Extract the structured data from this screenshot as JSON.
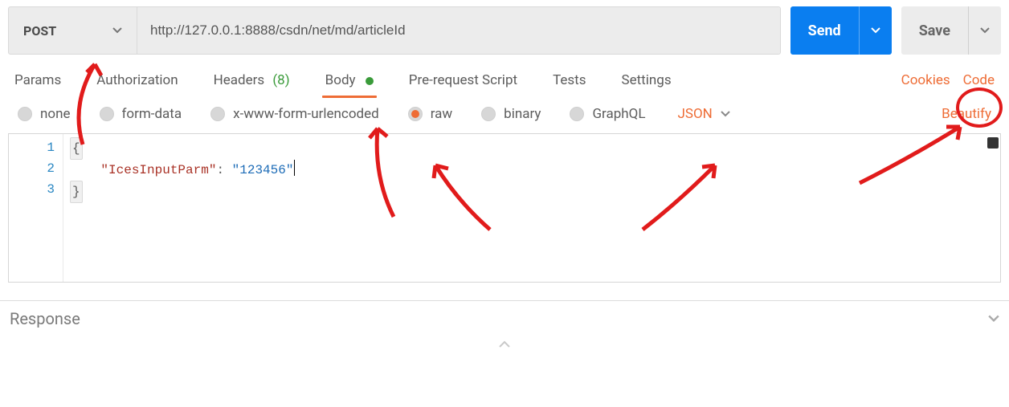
{
  "request": {
    "method": "POST",
    "url": "http://127.0.0.1:8888/csdn/net/md/articleId",
    "send_label": "Send",
    "save_label": "Save"
  },
  "tabs": {
    "params": "Params",
    "authorization": "Authorization",
    "headers": "Headers",
    "headers_count": "(8)",
    "body": "Body",
    "prerequest": "Pre-request Script",
    "tests": "Tests",
    "settings": "Settings",
    "cookies": "Cookies",
    "code": "Code"
  },
  "body_types": {
    "none": "none",
    "form_data": "form-data",
    "x_www": "x-www-form-urlencoded",
    "raw": "raw",
    "binary": "binary",
    "graphql": "GraphQL",
    "content_type": "JSON",
    "beautify": "Beautify"
  },
  "editor": {
    "gutter": [
      "1",
      "2",
      "3"
    ],
    "lines": {
      "open_brace": "{",
      "indent": "    ",
      "key_quoted": "\"IcesInputParm\"",
      "colon": ": ",
      "val_quoted": "\"123456\"",
      "close_brace": "}"
    }
  },
  "response": {
    "label": "Response"
  },
  "colors": {
    "orange": "#ee6c35",
    "blue": "#0a7ef0",
    "annotation": "#e11b1b"
  },
  "chart_data": null
}
